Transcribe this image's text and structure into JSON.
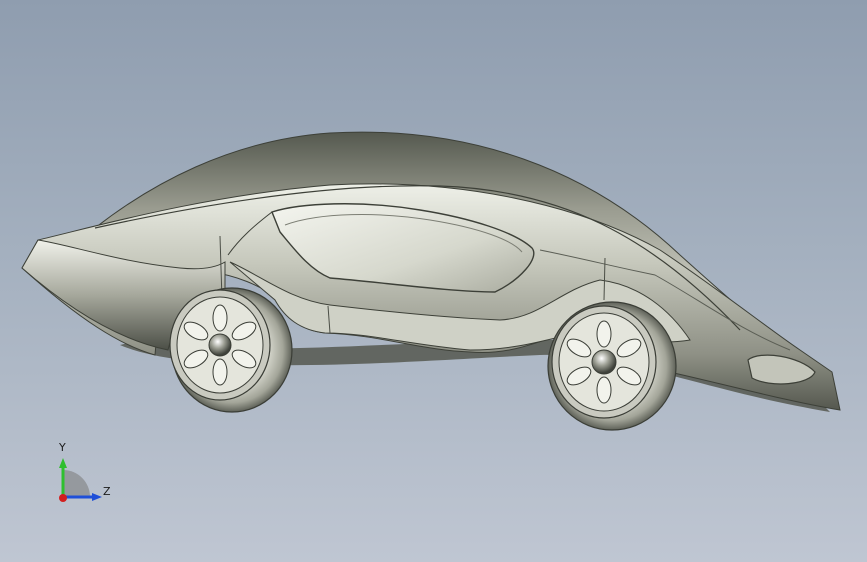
{
  "viewport": {
    "background_top": "#8f9daf",
    "background_bottom": "#bfc6d2",
    "model_color": "#b9bab0"
  },
  "triad": {
    "y_label": "Y",
    "z_label": "Z",
    "y_axis_color": "#2fbf2f",
    "z_axis_color": "#1f4fd8",
    "x_axis_color": "#d21f1f"
  }
}
